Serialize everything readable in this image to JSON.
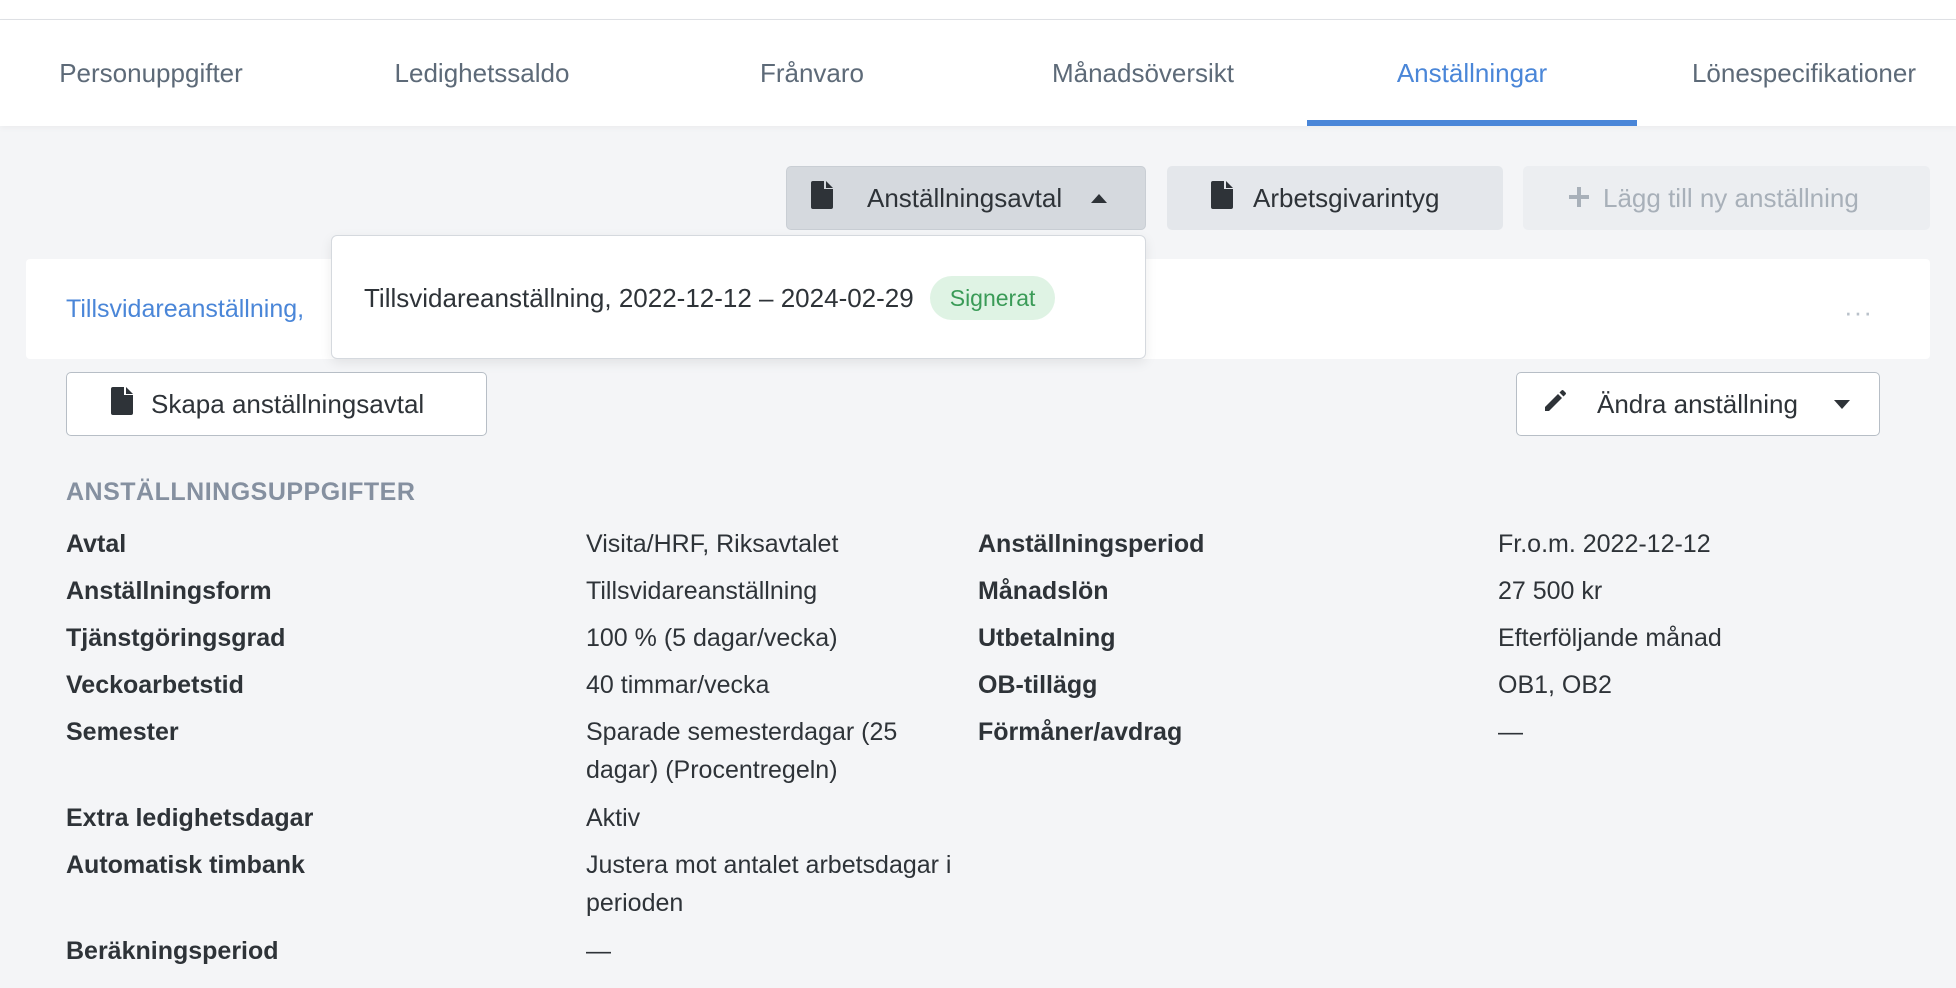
{
  "tabs": [
    {
      "label": "Personuppgifter",
      "active": false
    },
    {
      "label": "Ledighetssaldo",
      "active": false
    },
    {
      "label": "Frånvaro",
      "active": false
    },
    {
      "label": "Månadsöversikt",
      "active": false
    },
    {
      "label": "Anställningar",
      "active": true
    },
    {
      "label": "Lönespecifikationer",
      "active": false
    }
  ],
  "toolbar": {
    "agreement_label": "Anställningsavtal",
    "agreement_icon": "document-icon",
    "certificate_label": "Arbetsgivarintyg",
    "certificate_icon": "document-icon",
    "add_label": "Lägg till ny anställning",
    "add_icon": "plus-icon"
  },
  "dropdown": {
    "item_label": "Tillsvidareanställning, 2022-12-12 – 2024-02-29",
    "item_badge": "Signerat"
  },
  "card": {
    "title": "Tillsvidareanställning,",
    "more_label": "···",
    "create_label": "Skapa anställningsavtal",
    "edit_label": "Ändra anställning",
    "edit_icon": "pencil-icon"
  },
  "details": {
    "heading": "ANSTÄLLNINGSUPPGIFTER",
    "left": [
      {
        "label": "Avtal",
        "value": "Visita/HRF, Riksavtalet"
      },
      {
        "label": "Anställningsform",
        "value": "Tillsvidareanställning"
      },
      {
        "label": "Tjänstgöringsgrad",
        "value": "100 % (5 dagar/vecka)"
      },
      {
        "label": "Veckoarbetstid",
        "value": "40 timmar/vecka"
      },
      {
        "label": "Semester",
        "value": "Sparade semesterdagar (25 dagar) (Procentregeln)"
      },
      {
        "label": "Extra ledighetsdagar",
        "value": "Aktiv"
      },
      {
        "label": "Automatisk timbank",
        "value": "Justera mot antalet arbetsdagar i perioden"
      },
      {
        "label": "Beräkningsperiod",
        "value": "—"
      }
    ],
    "right": [
      {
        "label": "Anställningsperiod",
        "value": "Fr.o.m. 2022-12-12"
      },
      {
        "label": "Månadslön",
        "value": "27 500 kr"
      },
      {
        "label": "Utbetalning",
        "value": "Efterföljande månad"
      },
      {
        "label": "OB-tillägg",
        "value": "OB1, OB2"
      },
      {
        "label": "Förmåner/avdrag",
        "value": "—"
      }
    ]
  },
  "colors": {
    "accent": "#4a86d8",
    "success_bg": "#dff3e4",
    "success_text": "#3a9b57"
  }
}
